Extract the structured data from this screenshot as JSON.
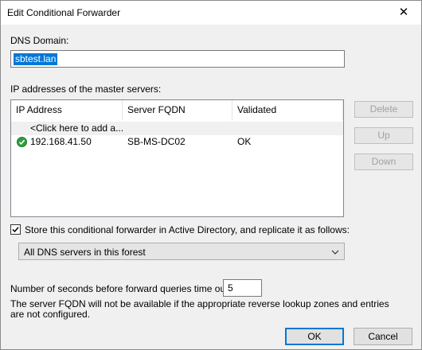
{
  "window": {
    "title": "Edit Conditional Forwarder",
    "close_glyph": "✕"
  },
  "dns_domain": {
    "label": "DNS Domain:",
    "value": "sbtest.lan"
  },
  "master_servers": {
    "label": "IP addresses of the master servers:",
    "columns": [
      "IP Address",
      "Server FQDN",
      "Validated"
    ],
    "add_placeholder": "<Click here to add a...",
    "rows": [
      {
        "ip": "192.168.41.50",
        "fqdn": "SB-MS-DC02",
        "validated": "OK",
        "status_icon": "check-circle-icon",
        "status_color": "#2e9e3c"
      }
    ]
  },
  "side_buttons": {
    "delete": "Delete",
    "up": "Up",
    "down": "Down"
  },
  "replication": {
    "checkbox_label": "Store this conditional forwarder in Active Directory, and replicate it as follows:",
    "checked": true,
    "scope_selected": "All DNS servers in this forest"
  },
  "timeout": {
    "label": "Number of seconds before forward queries time out:",
    "value": "5"
  },
  "note": "The server FQDN will not be available if the appropriate reverse lookup zones and entries are not configured.",
  "footer": {
    "ok": "OK",
    "cancel": "Cancel"
  },
  "colors": {
    "accent": "#0078d7",
    "disabled_text": "#a0a0a0",
    "dialog_bg": "#f0f0f0"
  }
}
